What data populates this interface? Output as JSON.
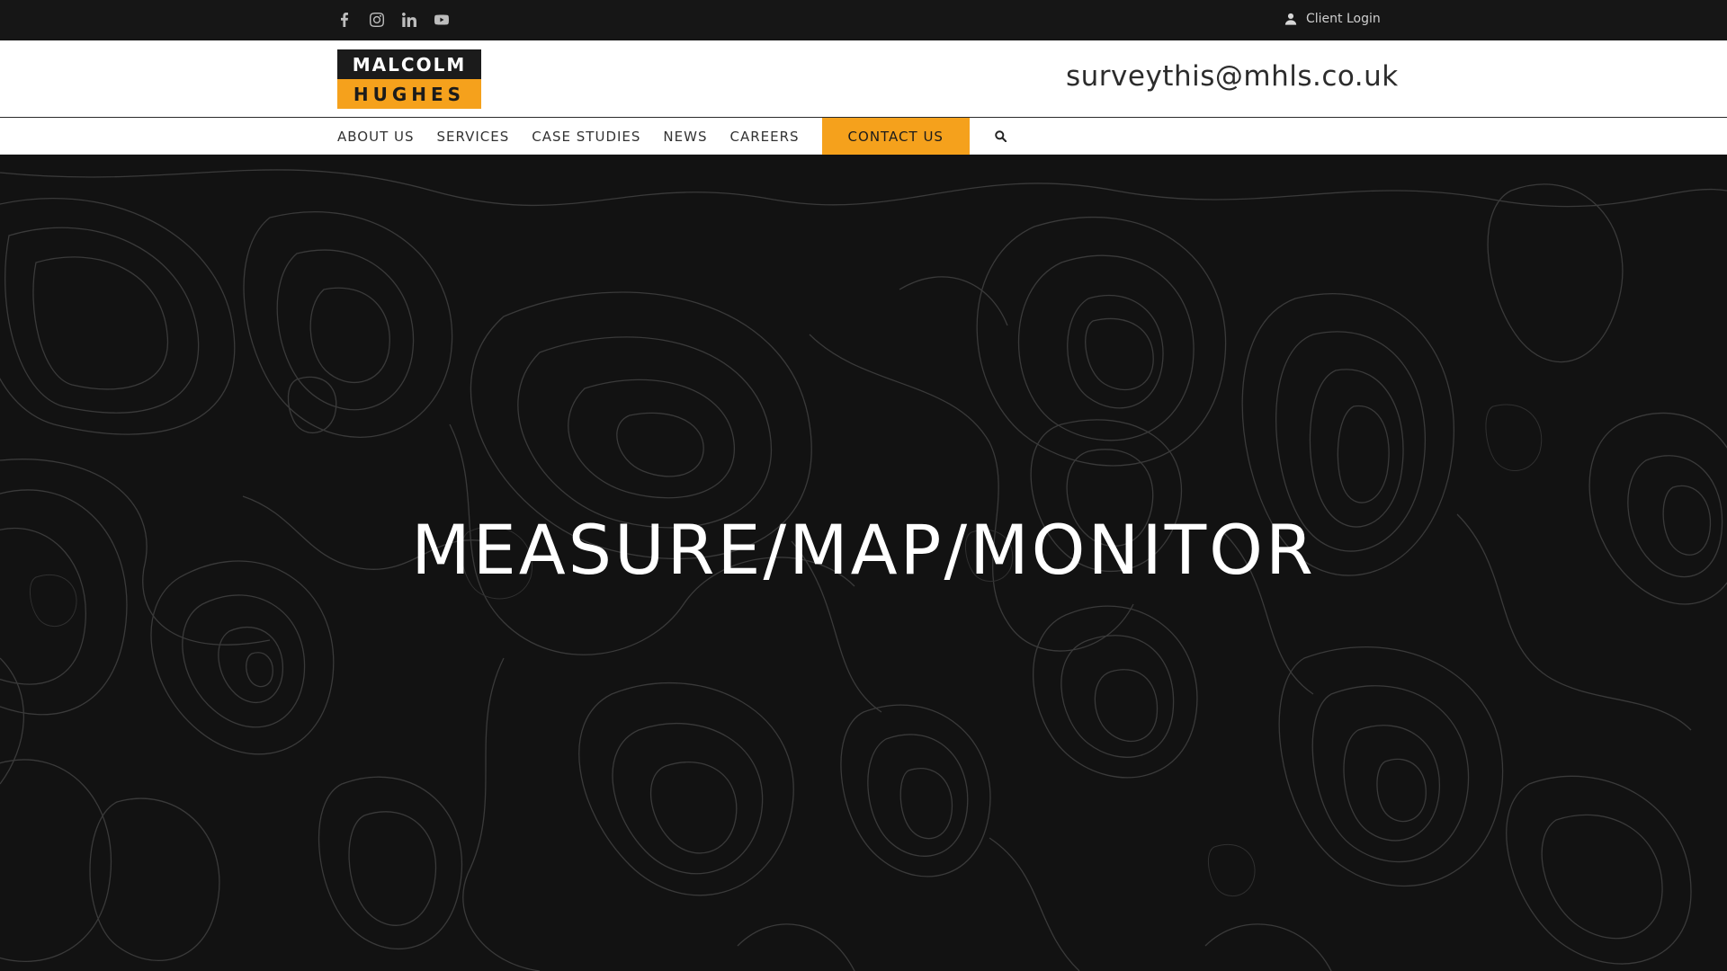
{
  "topbar": {
    "socials": [
      {
        "icon": "facebook-icon"
      },
      {
        "icon": "instagram-icon"
      },
      {
        "icon": "linkedin-icon"
      },
      {
        "icon": "youtube-icon"
      }
    ],
    "client_login": "Client Login"
  },
  "header": {
    "logo_top": "MALCOLM",
    "logo_bottom": "HUGHES",
    "email": "surveythis@mhls.co.uk"
  },
  "nav": {
    "items": [
      "ABOUT US",
      "SERVICES",
      "CASE STUDIES",
      "NEWS",
      "CAREERS"
    ],
    "contact": "CONTACT US"
  },
  "hero": {
    "title": "MEASURE/MAP/MONITOR"
  },
  "colors": {
    "accent": "#f5a11c",
    "dark": "#121212",
    "topbar": "#161616"
  }
}
